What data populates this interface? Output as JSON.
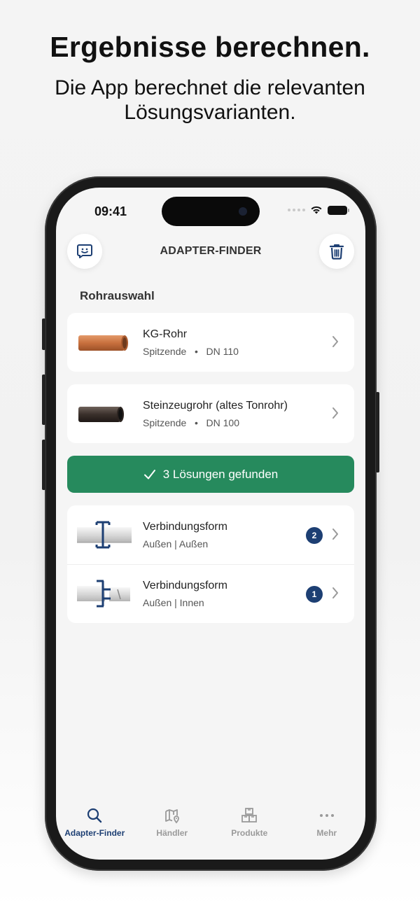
{
  "headline": "Ergebnisse berechnen.",
  "subline": "Die App berechnet die relevanten Lösungsvarianten.",
  "status": {
    "time": "09:41"
  },
  "header": {
    "title": "ADAPTER-FINDER",
    "left_icon": "feedback-smiley-icon",
    "right_icon": "trash-icon"
  },
  "section_label": "Rohrauswahl",
  "pipes": [
    {
      "title": "KG-Rohr",
      "end": "Spitzende",
      "dn": "DN 110",
      "color": "#c8703e"
    },
    {
      "title": "Steinzeugrohr (altes Tonrohr)",
      "end": "Spitzende",
      "dn": "DN 100",
      "color": "#3a302b"
    }
  ],
  "result_banner": {
    "icon": "checkmark-icon",
    "label": "3 Lösungen gefunden",
    "color": "#268a5d"
  },
  "solutions": [
    {
      "title": "Verbindungsform",
      "sub": "Außen | Außen",
      "count": "2"
    },
    {
      "title": "Verbindungsform",
      "sub": "Außen | Innen",
      "count": "1"
    }
  ],
  "tabbar": [
    {
      "label": "Adapter-Finder",
      "icon": "search-icon",
      "active": true
    },
    {
      "label": "Händler",
      "icon": "map-pin-icon",
      "active": false
    },
    {
      "label": "Produkte",
      "icon": "boxes-icon",
      "active": false
    },
    {
      "label": "Mehr",
      "icon": "more-dots-icon",
      "active": false
    }
  ],
  "colors": {
    "accent": "#1d3f73",
    "success": "#268a5d",
    "background": "#f5f5f5"
  }
}
